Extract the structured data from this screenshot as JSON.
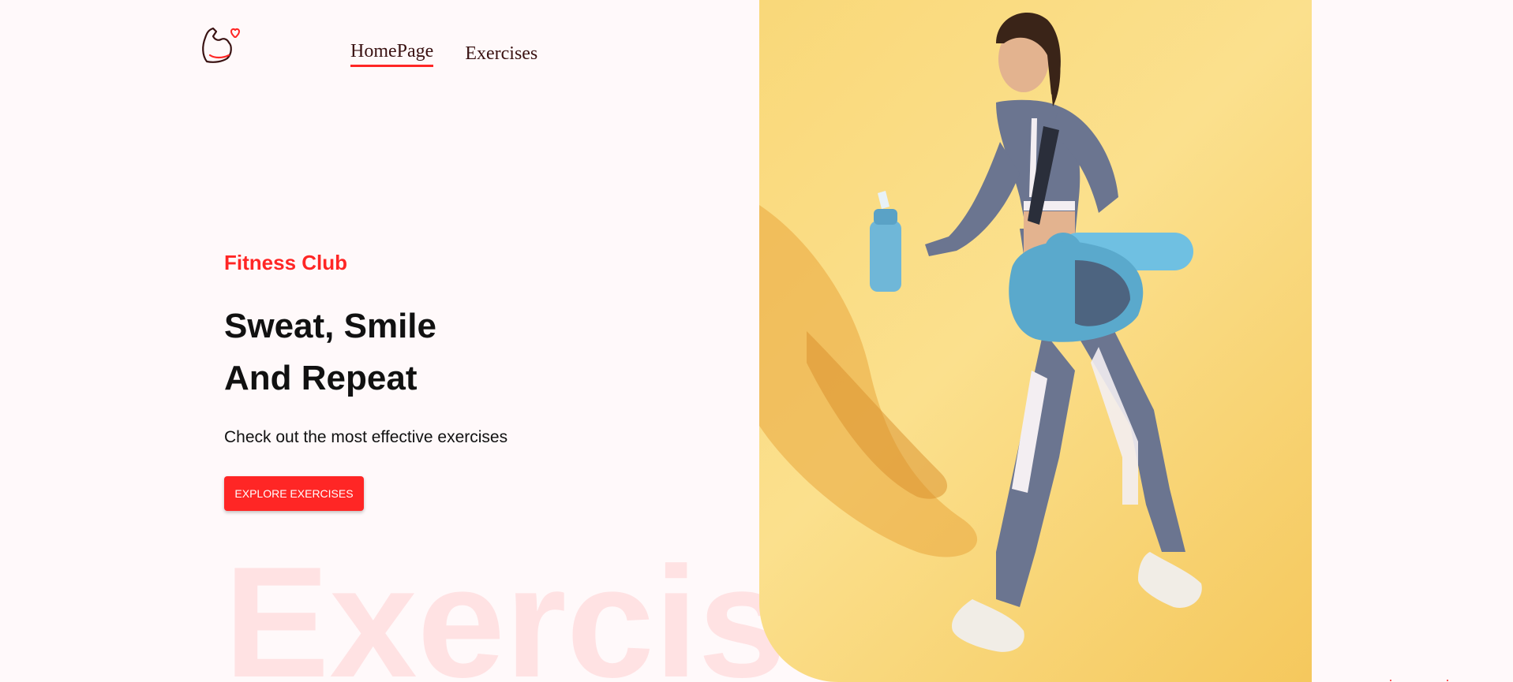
{
  "logo": {
    "icon": "flexed-arm-heart-icon",
    "accent": "#ff2625"
  },
  "nav": {
    "items": [
      {
        "label": "HomePage",
        "active": true
      },
      {
        "label": "Exercises",
        "active": false
      }
    ]
  },
  "hero": {
    "eyebrow": "Fitness Club",
    "headline": [
      "Sweat, Smile",
      "And Repeat"
    ],
    "subtitle": "Check out the most effective exercises",
    "cta_label": "EXPLORE EXERCISES",
    "watermark": "Exercises"
  },
  "banner": {
    "subject": "woman-walking-with-gym-bag-and-shaker",
    "background": "#fbe08d"
  },
  "colors": {
    "accent": "#ff2625",
    "page_background": "#fff9fa",
    "text": "#111111"
  }
}
